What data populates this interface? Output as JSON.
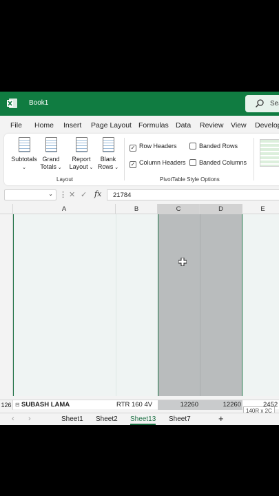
{
  "window": {
    "title": "Book1",
    "search_text": "Sea"
  },
  "menu": [
    "File",
    "Home",
    "Insert",
    "Page Layout",
    "Formulas",
    "Data",
    "Review",
    "View",
    "Develop"
  ],
  "ribbon": {
    "layout_buttons": [
      {
        "line1": "Subtotals",
        "line2": ""
      },
      {
        "line1": "Grand",
        "line2": "Totals"
      },
      {
        "line1": "Report",
        "line2": "Layout"
      },
      {
        "line1": "Blank",
        "line2": "Rows"
      }
    ],
    "layout_group_label": "Layout",
    "options": {
      "row_headers": "Row Headers",
      "column_headers": "Column Headers",
      "banded_rows": "Banded Rows",
      "banded_columns": "Banded Columns",
      "row_headers_checked": true,
      "column_headers_checked": true,
      "banded_rows_checked": false,
      "banded_columns_checked": false
    },
    "options_group_label": "PivotTable Style Options"
  },
  "formula_bar": {
    "name_box": "",
    "fx": "fx",
    "value": "21784"
  },
  "columns": [
    "A",
    "B",
    "C",
    "D",
    "E"
  ],
  "selected_columns": [
    "C",
    "D"
  ],
  "last_row": {
    "row_number": "126",
    "expand_glyph": "⊟",
    "name": "SUBASH LAMA",
    "model": "RTR 160 4V",
    "c": "12260",
    "d": "12260",
    "e": "2452"
  },
  "selection_tooltip": "140R x 2C",
  "sheet_tabs": [
    "Sheet1",
    "Sheet2",
    "Sheet13",
    "Sheet7"
  ],
  "active_sheet": "Sheet13",
  "add_sheet": "+",
  "colors": {
    "excel_green": "#107c41",
    "selection": "#b9bcbd"
  }
}
